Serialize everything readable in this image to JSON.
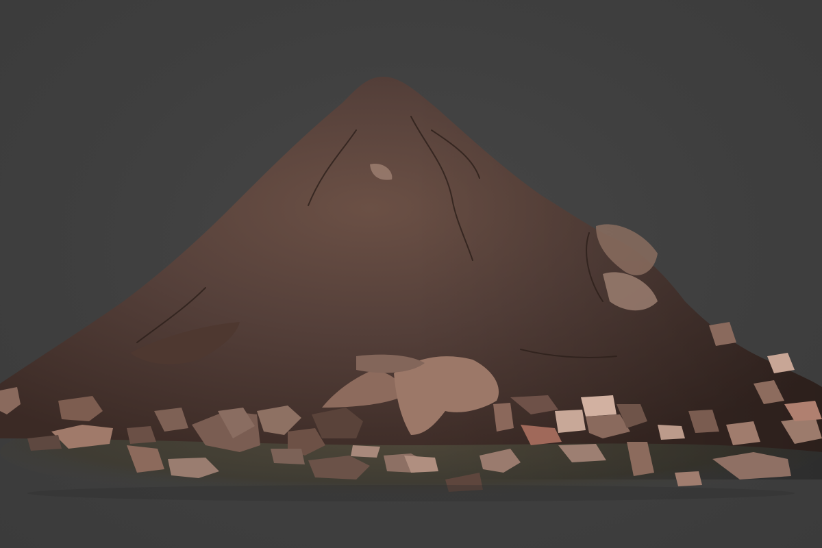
{
  "scene": {
    "background_color": "#3f3f3f",
    "subject": "dirt-mound-with-rocks",
    "palette": {
      "soil_dark": "#3a2a24",
      "soil_mid": "#5a433a",
      "soil_light": "#7a5e52",
      "rock_light": "#9b7a6a",
      "rock_mid": "#7d5d50",
      "rock_dark": "#4b352d",
      "grass": "#4a4638"
    }
  }
}
